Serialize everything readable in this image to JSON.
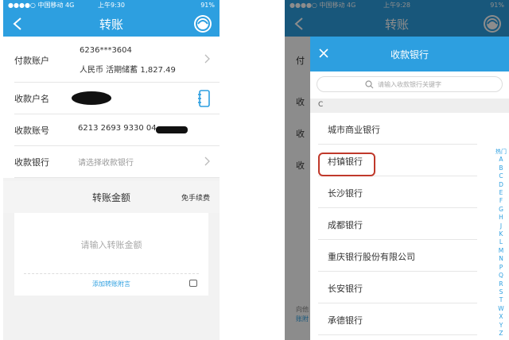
{
  "left": {
    "status": {
      "carrier": "●●●●○ 中国移动 4G",
      "time": "上午9:30",
      "battery": "91%"
    },
    "title": "转账",
    "form": {
      "payer_label": "付款账户",
      "payer_account": "6236***3604",
      "payer_detail": "人民币 活期储蓄 1,827.49",
      "payee_name_label": "收款户名",
      "payee_account_label": "收款账号",
      "payee_account_value": "6213 2693 9330 04",
      "payee_bank_label": "收款银行",
      "payee_bank_placeholder": "请选择收款银行"
    },
    "amount": {
      "title": "转账金额",
      "fee_note": "免手续费",
      "placeholder": "请输入转账金额",
      "add_note": "添加转账附言"
    }
  },
  "right": {
    "status": {
      "carrier": "●●●●○ 中国移动 4G",
      "time": "上午9:28",
      "battery": "91%"
    },
    "title": "转账",
    "bg_rows": [
      "付",
      "收",
      "收",
      "收"
    ],
    "bg_footer": [
      "向他",
      "账附"
    ],
    "picker": {
      "title": "收款银行",
      "search_placeholder": "请输入收款银行关键字",
      "section": "C",
      "banks": [
        "城市商业银行",
        "村镇银行",
        "长沙银行",
        "成都银行",
        "重庆银行股份有限公司",
        "长安银行",
        "承德银行"
      ],
      "highlighted": "村镇银行",
      "index": [
        "热门",
        "A",
        "B",
        "C",
        "D",
        "E",
        "F",
        "G",
        "H",
        "J",
        "K",
        "L",
        "M",
        "N",
        "P",
        "Q",
        "R",
        "S",
        "T",
        "W",
        "X",
        "Y",
        "Z"
      ]
    }
  },
  "colors": {
    "accent": "#2d9fe0",
    "highlight": "#c0392b"
  }
}
